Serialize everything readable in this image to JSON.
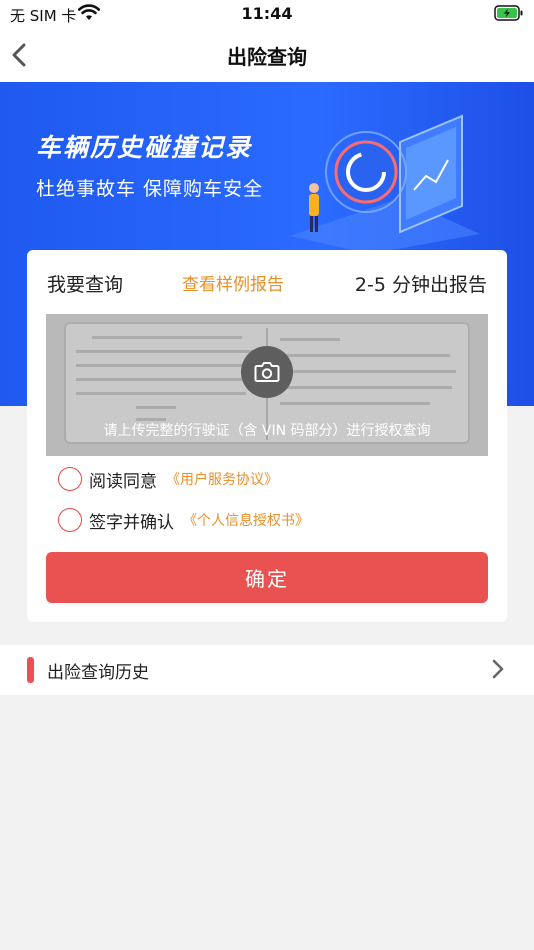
{
  "status_bar": {
    "carrier": "无 SIM 卡",
    "time": "11:44",
    "icons": [
      "wifi-icon",
      "battery-charging-icon"
    ]
  },
  "nav": {
    "title": "出险查询",
    "back_icon": "chevron-left-icon"
  },
  "banner": {
    "title": "车辆历史碰撞记录",
    "subtitle": "杜绝事故车  保障购车安全"
  },
  "query_card": {
    "left_label": "我要查询",
    "sample_link": "查看样例报告",
    "right_label": "2-5 分钟出报告",
    "upload_hint": "请上传完整的行驶证（含 VIN 码部分）进行授权查询",
    "upload_icon": "camera-icon",
    "agreements": [
      {
        "label": "阅读同意",
        "link": "《用户服务协议》"
      },
      {
        "label": "签字并确认",
        "link": "《个人信息授权书》"
      }
    ],
    "confirm_label": "确定"
  },
  "history": {
    "label": "出险查询历史",
    "chevron_icon": "chevron-right-icon"
  },
  "colors": {
    "primary_red": "#ea5151",
    "link_orange": "#e8902a",
    "banner_blue": "#2b6bff"
  }
}
